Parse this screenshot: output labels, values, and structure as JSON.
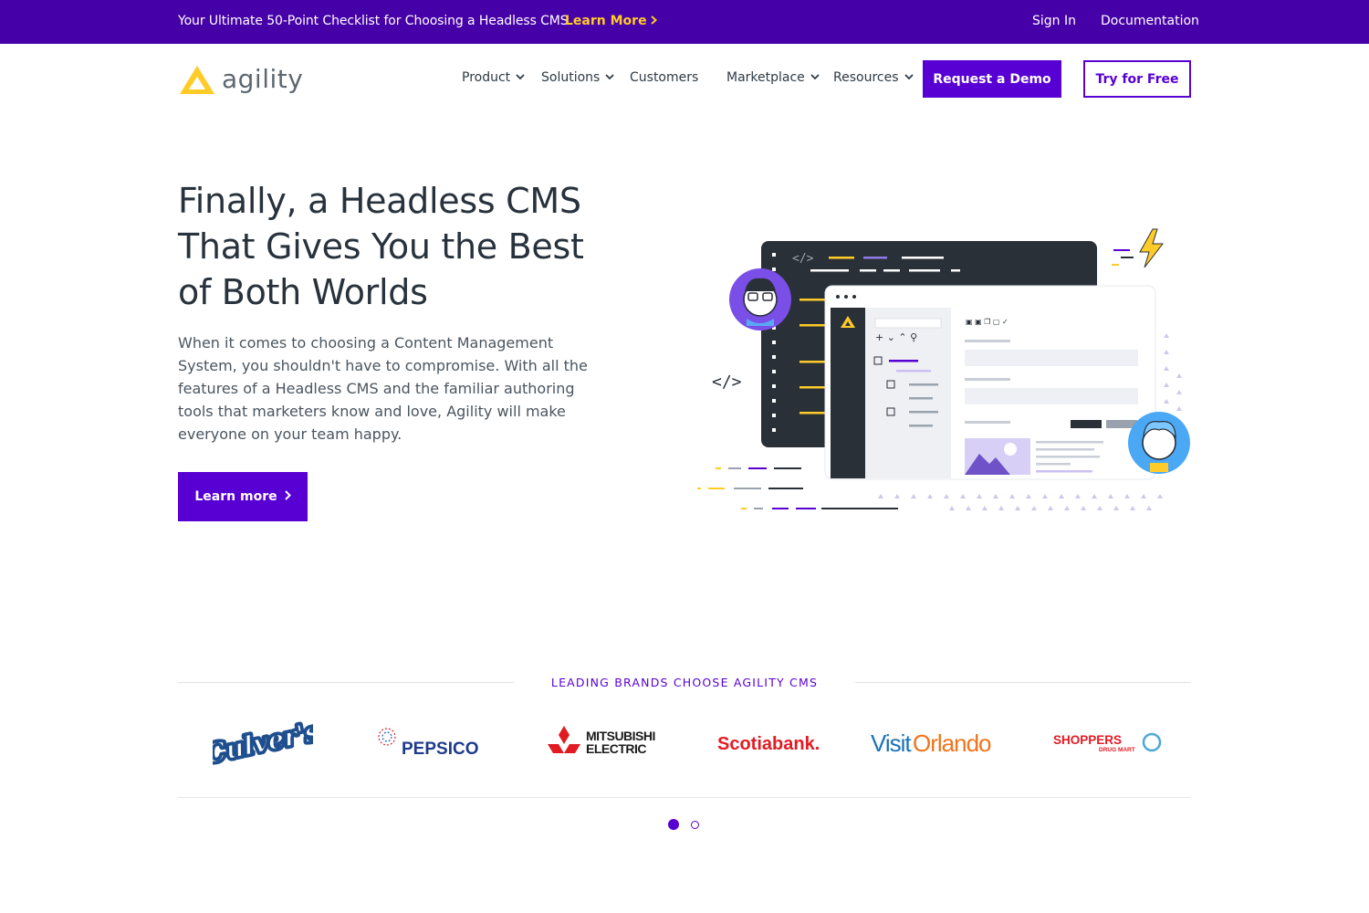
{
  "announcement": {
    "text": "Your Ultimate 50-Point Checklist for Choosing a Headless CMS",
    "link_label": "Learn More",
    "sign_in": "Sign In",
    "documentation": "Documentation"
  },
  "header": {
    "logo_text": "agility",
    "nav": [
      {
        "label": "Product",
        "dropdown": true
      },
      {
        "label": "Solutions",
        "dropdown": true
      },
      {
        "label": "Customers",
        "dropdown": false
      },
      {
        "label": "Marketplace",
        "dropdown": true
      },
      {
        "label": "Resources",
        "dropdown": true
      }
    ],
    "demo_button": "Request a Demo",
    "try_button": "Try for Free"
  },
  "hero": {
    "title_lines": [
      "Finally, a Headless CMS",
      "That Gives You the Best",
      "of Both Worlds"
    ],
    "body_lines": [
      "When it comes to choosing a Content Management",
      "System, you shouldn't have to compromise. With all the",
      "features of a Headless CMS and the familiar authoring",
      "tools that marketers know and love, Agility will make",
      "everyone on your team happy."
    ],
    "cta": "Learn more",
    "code_tag": "</>"
  },
  "brands": {
    "heading": "LEADING BRANDS CHOOSE AGILITY CMS",
    "logos": [
      "Culver's",
      "PEPSICO",
      "MITSUBISHI ELECTRIC",
      "Scotiabank.",
      "VisitOrlando",
      "SHOPPERS DRUG MART"
    ],
    "carousel": {
      "pages": 2,
      "active": 1
    }
  },
  "colors": {
    "brand_purple": "#5800d4",
    "topbar_purple": "#4600a8",
    "accent_yellow": "#ffcb28"
  }
}
